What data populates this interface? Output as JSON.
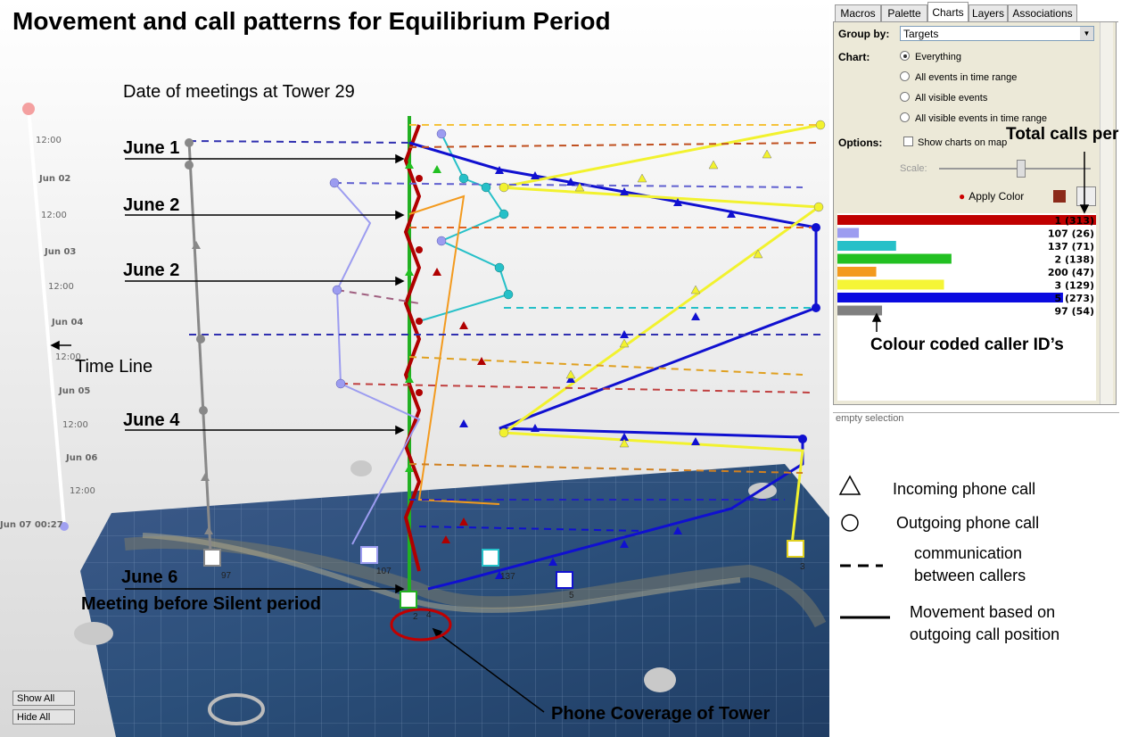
{
  "title": "Movement and call patterns for Equilibrium Period",
  "annotations": {
    "date_heading": "Date of meetings at Tower 29",
    "june1": "June 1",
    "june2a": "June 2",
    "june2b": "June 2",
    "june4": "June 4",
    "june6": "June 6",
    "meeting": "Meeting before Silent period",
    "timeline": "Time Line",
    "coverage": "Phone Coverage of Tower",
    "total_calls": "Total calls per ID",
    "colour_coded": "Colour coded caller ID’s"
  },
  "timeline": {
    "ticks": [
      "12:00",
      "Jun 02",
      "12:00",
      "Jun 03",
      "12:00",
      "Jun 04",
      "12:00",
      "Jun 05",
      "12:00",
      "Jun 06",
      "12:00"
    ],
    "end": "Jun 07 00:27"
  },
  "view_buttons": {
    "show_all": "Show All",
    "hide_all": "Hide All"
  },
  "map_badges": [
    "97",
    "107",
    "137",
    "5",
    "3",
    "2",
    "4"
  ],
  "tabs": [
    "Macros",
    "Palette",
    "Charts",
    "Layers",
    "Associations"
  ],
  "active_tab": "Charts",
  "charts": {
    "group_by_label": "Group by:",
    "group_by_value": "Targets",
    "chart_label": "Chart:",
    "radios": [
      "Everything",
      "All events in time range",
      "All visible events",
      "All visible events in time range"
    ],
    "selected_radio": "Everything",
    "options_label": "Options:",
    "show_on_map": "Show charts on map",
    "scale_label": "Scale:",
    "apply_color": "Apply Color"
  },
  "selection_pane": "empty selection",
  "legend": {
    "incoming": "Incoming  phone call",
    "outgoing": "Outgoing phone call",
    "communication_1": "communication",
    "communication_2": "between callers",
    "movement_1": "Movement based on",
    "movement_2": "outgoing call position"
  },
  "chart_data": {
    "type": "bar",
    "orientation": "horizontal",
    "title": "",
    "categories": [
      "1",
      "107",
      "137",
      "2",
      "200",
      "3",
      "5",
      "97"
    ],
    "values": [
      313,
      26,
      71,
      138,
      47,
      129,
      273,
      54
    ],
    "labels": [
      "1 (313)",
      "107 (26)",
      "137 (71)",
      "2 (138)",
      "200 (47)",
      "3 (129)",
      "5 (273)",
      "97 (54)"
    ],
    "colors": [
      "#c00000",
      "#9c9cf0",
      "#26c0c8",
      "#22c022",
      "#f39a1e",
      "#f5f536",
      "#0a0ae0",
      "#808080"
    ],
    "xlim": [
      0,
      313
    ]
  }
}
